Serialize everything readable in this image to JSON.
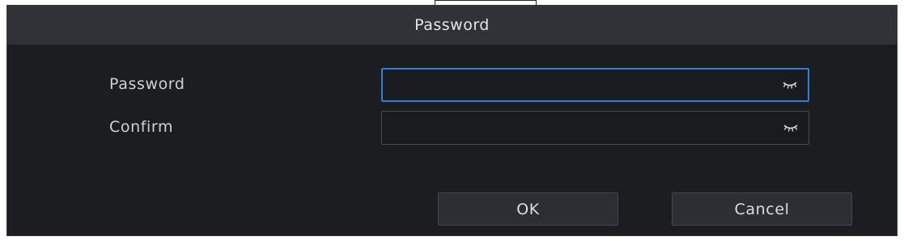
{
  "dialog": {
    "title": "Password",
    "fields": [
      {
        "label": "Password",
        "value": "",
        "placeholder": ""
      },
      {
        "label": "Confirm",
        "value": "",
        "placeholder": ""
      }
    ],
    "buttons": {
      "ok": "OK",
      "cancel": "Cancel"
    }
  },
  "colors": {
    "background": "#1c1d21",
    "titlebar": "#303238",
    "focus_border": "#2d7fd8",
    "text": "#d7d8dc"
  },
  "icons": {
    "reveal": "eye-closed-icon"
  }
}
